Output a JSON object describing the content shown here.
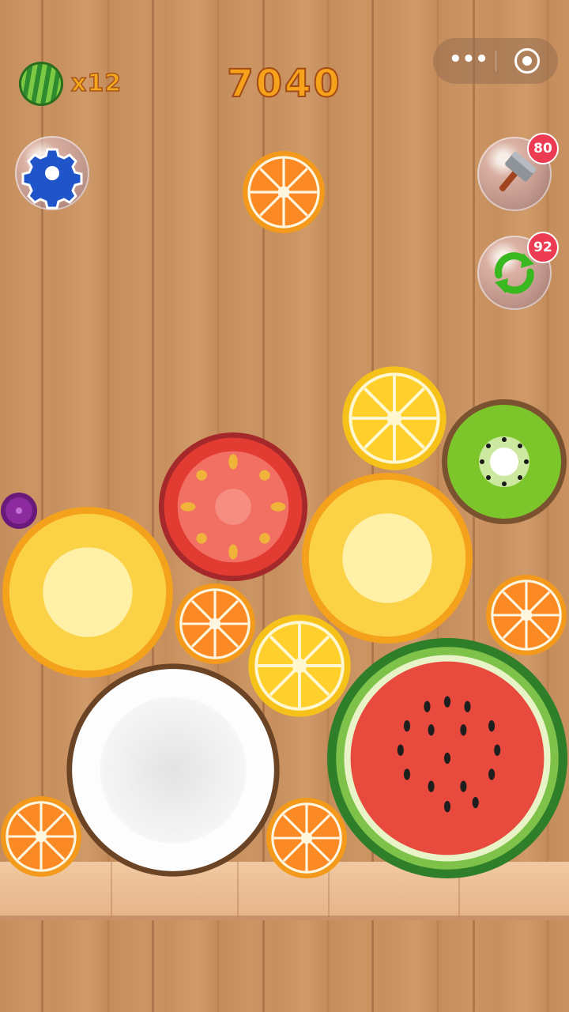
{
  "hud": {
    "melon_count": "x12",
    "score": "7040"
  },
  "tools": {
    "hammer_count": "80",
    "refresh_count": "92"
  },
  "next_fruit": "orange",
  "board_fruits": [
    "grape",
    "pineapple",
    "tomato",
    "lemon",
    "kiwi",
    "pineapple",
    "orange",
    "orange",
    "lemon",
    "coconut",
    "watermelon",
    "orange",
    "orange"
  ],
  "colors": {
    "score": "#f7a21b",
    "badge": "#ec3b52"
  }
}
